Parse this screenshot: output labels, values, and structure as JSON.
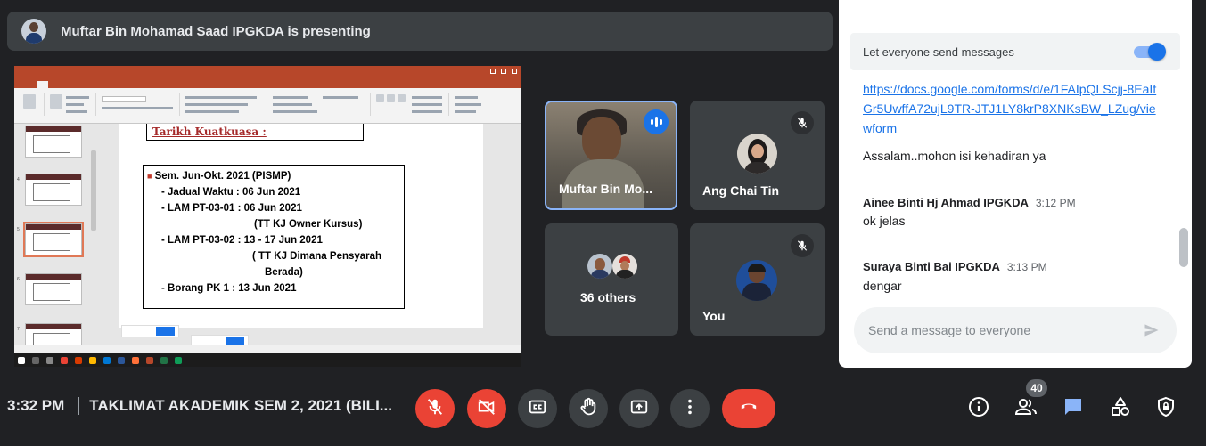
{
  "banner": {
    "presenter_text": "Muftar Bin Mohamad Saad IPGKDA is presenting"
  },
  "slide": {
    "title": "Tarikh Kuatkuasa :",
    "lines": [
      "Sem. Jun-Okt. 2021  (PISMP)",
      "- Jadual Waktu  : 06  Jun 2021",
      "- LAM PT-03-01 : 06  Jun 2021",
      "(TT KJ Owner Kursus)",
      "- LAM PT-03-02 : 13 - 17 Jun 2021",
      "( TT KJ Dimana Pensyarah",
      "Berada)",
      "- Borang PK 1   : 13  Jun 2021"
    ]
  },
  "participants": [
    {
      "name": "Muftar Bin Mo...",
      "state": "speaking"
    },
    {
      "name": "Ang Chai Tin",
      "state": "muted"
    },
    {
      "name": "36 others",
      "state": "group"
    },
    {
      "name": "You",
      "state": "muted"
    }
  ],
  "chat": {
    "toggle_label": "Let everyone send messages",
    "toggle_on": true,
    "messages": [
      {
        "link": "https://docs.google.com/forms/d/e/1FAIpQLScjj-8EaIfGr5UwffA72ujL9TR-JTJ1LY8krP8XNKsBW_LZug/viewform"
      },
      {
        "text": "Assalam..mohon isi kehadiran ya"
      },
      {
        "sender": "Ainee Binti Hj Ahmad IPGKDA",
        "time": "3:12 PM",
        "text": "ok jelas"
      },
      {
        "sender": "Suraya Binti Bai IPGKDA",
        "time": "3:13 PM",
        "text": "dengar"
      }
    ],
    "input_placeholder": "Send a message to everyone"
  },
  "bottom": {
    "time": "3:32 PM",
    "meeting_title": "TAKLIMAT AKADEMIK SEM 2, 2021 (BILI...",
    "people_count": "40"
  },
  "colors": {
    "background": "#202124",
    "tile": "#3c4043",
    "danger": "#ea4335",
    "accent": "#1a73e8",
    "speaking_border": "#8ab4f8"
  },
  "icons": [
    "mic-off-icon",
    "camera-off-icon",
    "captions-icon",
    "raise-hand-icon",
    "present-icon",
    "more-vert-icon",
    "end-call-icon",
    "info-icon",
    "people-icon",
    "chat-icon",
    "activities-icon",
    "host-controls-icon",
    "send-icon"
  ]
}
